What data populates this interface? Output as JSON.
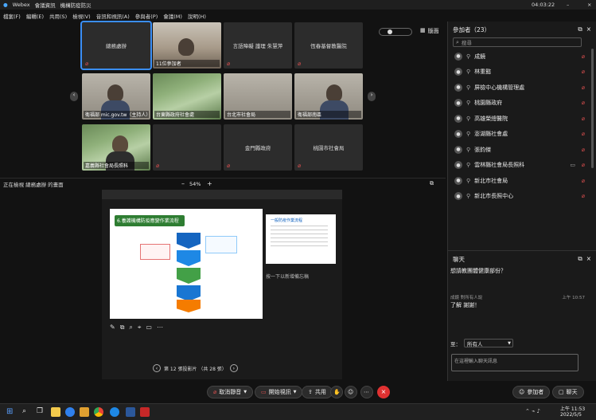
{
  "titlebar": {
    "app": "Webex",
    "meeting_info": "會議資訊",
    "title": "機構防疫防災",
    "clock": "04:03:22"
  },
  "menubar": [
    "檔案(F)",
    "編輯(E)",
    "共用(S)",
    "檢視(V)",
    "音訊和視訊(A)",
    "參與者(P)",
    "會議(M)",
    "說明(H)"
  ],
  "layout_button": "版面",
  "tiles": [
    {
      "name": "總務處辦",
      "caption": "",
      "selected": true,
      "style": "plain"
    },
    {
      "name": "",
      "caption": "11位參加者",
      "selected": false,
      "style": "room"
    },
    {
      "name": "言語障礙 護理 朱慧萍",
      "caption": "",
      "selected": false,
      "style": "plain"
    },
    {
      "name": "恆春基督教醫院",
      "caption": "",
      "selected": false,
      "style": "plain"
    },
    {
      "name": "",
      "caption": "衛福部 mic.gov.tw（主持人）",
      "selected": false,
      "style": "person"
    },
    {
      "name": "",
      "caption": "台東縣政府社會處",
      "selected": false,
      "style": "trees"
    },
    {
      "name": "",
      "caption": "台北市社會局",
      "selected": false,
      "style": "office"
    },
    {
      "name": "",
      "caption": "衛福部南區",
      "selected": false,
      "style": "person"
    },
    {
      "name": "",
      "caption": "嘉義縣社會局長照科",
      "selected": false,
      "style": "person"
    },
    {
      "name": "",
      "caption": "",
      "selected": false,
      "style": "plain"
    },
    {
      "name": "金門縣政府",
      "caption": "",
      "selected": false,
      "style": "plain"
    },
    {
      "name": "桃園市社會局",
      "caption": "",
      "selected": false,
      "style": "plain"
    }
  ],
  "share_bar": {
    "left": "正在檢視 總務處辦 的畫面",
    "zoom": "54%"
  },
  "slide": {
    "title": "6.養護機構防疫應變作業流程",
    "page_nav": "第 12 張投影片 （共 28 張）",
    "thumb_title": "一般防疫作業流程",
    "notes_placeholder": "按一下以新增備忘稿"
  },
  "participants": {
    "title": "參加者（23）",
    "search_placeholder": "搜尋",
    "list": [
      "成鏡",
      "林重懿",
      "屏檢中心機構管理處",
      "桃園縣政府",
      "高雄榮總醫院",
      "澎湖縣社會處",
      "張鈞傑",
      "雲林縣社會局長照科",
      "新北市社會局",
      "新北市長照中心"
    ]
  },
  "chat": {
    "title": "聊天",
    "message1": "想請教團體健康部份？",
    "sender": "成鏡 對所有人說",
    "time": "上午 10:57",
    "message2": "了解 謝謝！",
    "to_label": "至：",
    "to_value": "所有人",
    "input_placeholder": "在這裡輸入聊天訊息"
  },
  "toolbar": {
    "mute": "取消靜音",
    "video": "開始視訊",
    "share": "共用",
    "participants_btn": "參加者",
    "chat_btn": "聊天"
  },
  "taskbar": {
    "time": "上午 11:53",
    "date": "2022/5/5"
  },
  "colors": {
    "accent": "#3a8ef5",
    "end": "#e03131",
    "muted": "#e05050"
  }
}
